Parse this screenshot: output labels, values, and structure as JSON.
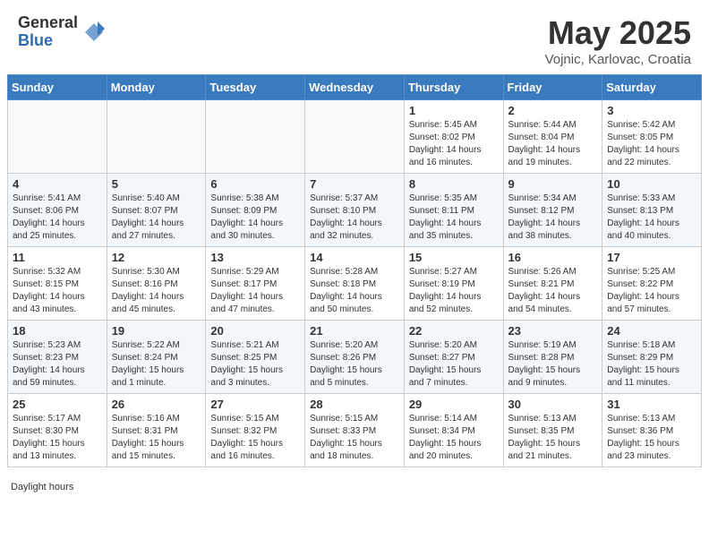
{
  "header": {
    "logo_general": "General",
    "logo_blue": "Blue",
    "month_title": "May 2025",
    "location": "Vojnic, Karlovac, Croatia"
  },
  "weekdays": [
    "Sunday",
    "Monday",
    "Tuesday",
    "Wednesday",
    "Thursday",
    "Friday",
    "Saturday"
  ],
  "weeks": [
    [
      {
        "day": "",
        "empty": true
      },
      {
        "day": "",
        "empty": true
      },
      {
        "day": "",
        "empty": true
      },
      {
        "day": "",
        "empty": true
      },
      {
        "day": "1",
        "sunrise": "5:45 AM",
        "sunset": "8:02 PM",
        "daylight": "14 hours and 16 minutes."
      },
      {
        "day": "2",
        "sunrise": "5:44 AM",
        "sunset": "8:04 PM",
        "daylight": "14 hours and 19 minutes."
      },
      {
        "day": "3",
        "sunrise": "5:42 AM",
        "sunset": "8:05 PM",
        "daylight": "14 hours and 22 minutes."
      }
    ],
    [
      {
        "day": "4",
        "sunrise": "5:41 AM",
        "sunset": "8:06 PM",
        "daylight": "14 hours and 25 minutes."
      },
      {
        "day": "5",
        "sunrise": "5:40 AM",
        "sunset": "8:07 PM",
        "daylight": "14 hours and 27 minutes."
      },
      {
        "day": "6",
        "sunrise": "5:38 AM",
        "sunset": "8:09 PM",
        "daylight": "14 hours and 30 minutes."
      },
      {
        "day": "7",
        "sunrise": "5:37 AM",
        "sunset": "8:10 PM",
        "daylight": "14 hours and 32 minutes."
      },
      {
        "day": "8",
        "sunrise": "5:35 AM",
        "sunset": "8:11 PM",
        "daylight": "14 hours and 35 minutes."
      },
      {
        "day": "9",
        "sunrise": "5:34 AM",
        "sunset": "8:12 PM",
        "daylight": "14 hours and 38 minutes."
      },
      {
        "day": "10",
        "sunrise": "5:33 AM",
        "sunset": "8:13 PM",
        "daylight": "14 hours and 40 minutes."
      }
    ],
    [
      {
        "day": "11",
        "sunrise": "5:32 AM",
        "sunset": "8:15 PM",
        "daylight": "14 hours and 43 minutes."
      },
      {
        "day": "12",
        "sunrise": "5:30 AM",
        "sunset": "8:16 PM",
        "daylight": "14 hours and 45 minutes."
      },
      {
        "day": "13",
        "sunrise": "5:29 AM",
        "sunset": "8:17 PM",
        "daylight": "14 hours and 47 minutes."
      },
      {
        "day": "14",
        "sunrise": "5:28 AM",
        "sunset": "8:18 PM",
        "daylight": "14 hours and 50 minutes."
      },
      {
        "day": "15",
        "sunrise": "5:27 AM",
        "sunset": "8:19 PM",
        "daylight": "14 hours and 52 minutes."
      },
      {
        "day": "16",
        "sunrise": "5:26 AM",
        "sunset": "8:21 PM",
        "daylight": "14 hours and 54 minutes."
      },
      {
        "day": "17",
        "sunrise": "5:25 AM",
        "sunset": "8:22 PM",
        "daylight": "14 hours and 57 minutes."
      }
    ],
    [
      {
        "day": "18",
        "sunrise": "5:23 AM",
        "sunset": "8:23 PM",
        "daylight": "14 hours and 59 minutes."
      },
      {
        "day": "19",
        "sunrise": "5:22 AM",
        "sunset": "8:24 PM",
        "daylight": "15 hours and 1 minute."
      },
      {
        "day": "20",
        "sunrise": "5:21 AM",
        "sunset": "8:25 PM",
        "daylight": "15 hours and 3 minutes."
      },
      {
        "day": "21",
        "sunrise": "5:20 AM",
        "sunset": "8:26 PM",
        "daylight": "15 hours and 5 minutes."
      },
      {
        "day": "22",
        "sunrise": "5:20 AM",
        "sunset": "8:27 PM",
        "daylight": "15 hours and 7 minutes."
      },
      {
        "day": "23",
        "sunrise": "5:19 AM",
        "sunset": "8:28 PM",
        "daylight": "15 hours and 9 minutes."
      },
      {
        "day": "24",
        "sunrise": "5:18 AM",
        "sunset": "8:29 PM",
        "daylight": "15 hours and 11 minutes."
      }
    ],
    [
      {
        "day": "25",
        "sunrise": "5:17 AM",
        "sunset": "8:30 PM",
        "daylight": "15 hours and 13 minutes."
      },
      {
        "day": "26",
        "sunrise": "5:16 AM",
        "sunset": "8:31 PM",
        "daylight": "15 hours and 15 minutes."
      },
      {
        "day": "27",
        "sunrise": "5:15 AM",
        "sunset": "8:32 PM",
        "daylight": "15 hours and 16 minutes."
      },
      {
        "day": "28",
        "sunrise": "5:15 AM",
        "sunset": "8:33 PM",
        "daylight": "15 hours and 18 minutes."
      },
      {
        "day": "29",
        "sunrise": "5:14 AM",
        "sunset": "8:34 PM",
        "daylight": "15 hours and 20 minutes."
      },
      {
        "day": "30",
        "sunrise": "5:13 AM",
        "sunset": "8:35 PM",
        "daylight": "15 hours and 21 minutes."
      },
      {
        "day": "31",
        "sunrise": "5:13 AM",
        "sunset": "8:36 PM",
        "daylight": "15 hours and 23 minutes."
      }
    ]
  ],
  "footer": {
    "daylight_hours": "Daylight hours"
  }
}
